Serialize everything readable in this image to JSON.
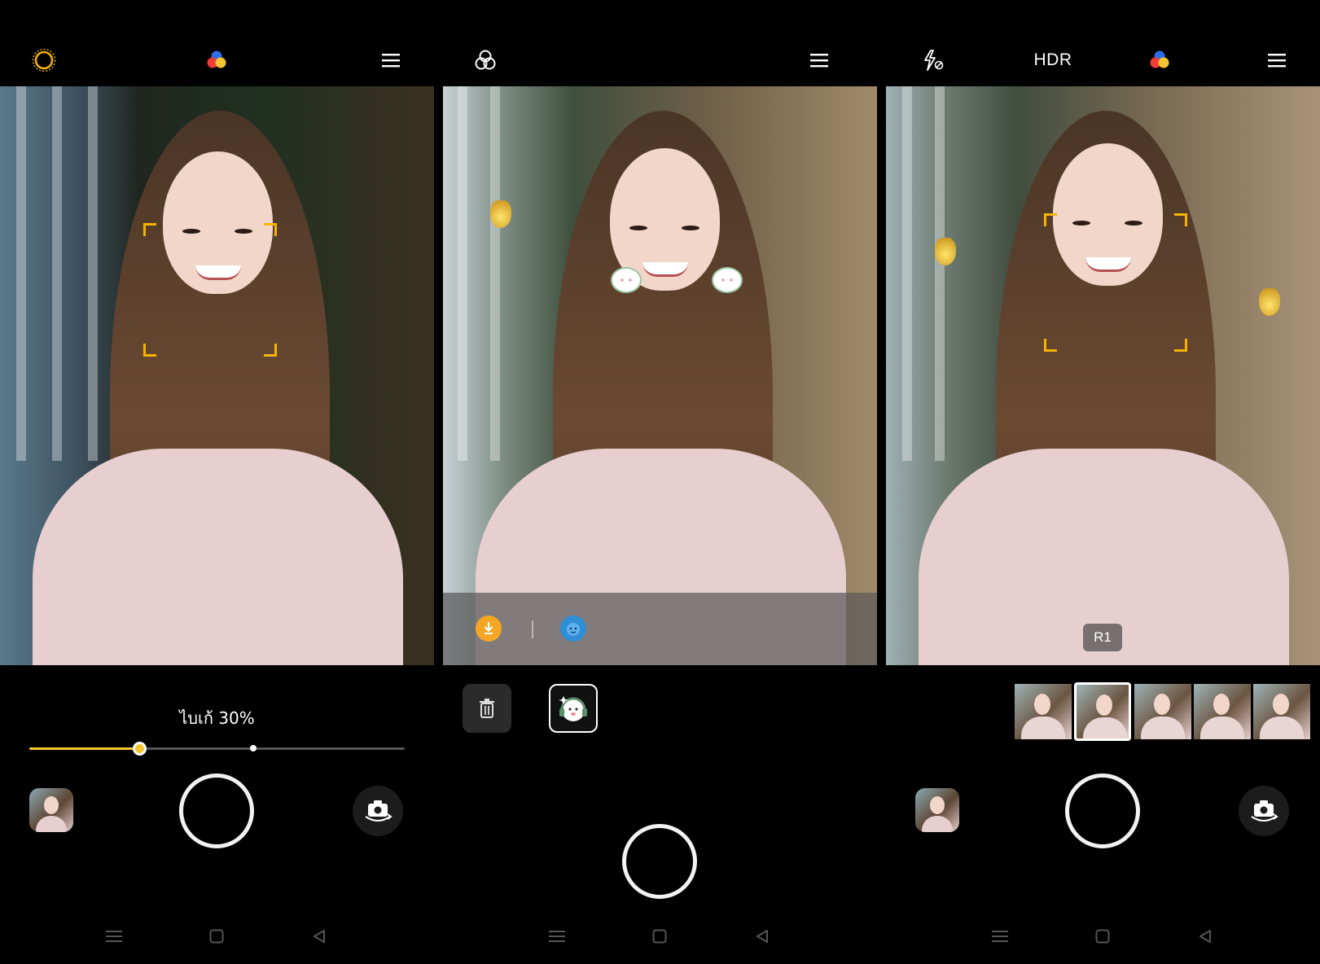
{
  "screens": [
    {
      "name": "beauty-mode",
      "topbar": {
        "left_icon": "sun-icon",
        "center_icon": "color-filter-icon",
        "right_icon": "menu-icon"
      },
      "beauty": {
        "label": "ไบเก้ 30%",
        "level": 0.3
      },
      "controls": {
        "thumbnail": "gallery-thumbnail",
        "shutter": "shutter-button",
        "flip": "camera-flip-icon"
      }
    },
    {
      "name": "sticker-mode",
      "topbar": {
        "left_icon": "filters-icon",
        "right_icon": "menu-icon"
      },
      "sticker_bar": {
        "items": [
          "download-icon",
          "sticker-face-icon"
        ]
      },
      "sticker_actions": {
        "delete": "trash-icon",
        "selected": "headphone-cat-sticker-icon"
      },
      "controls": {
        "shutter": "shutter-button"
      }
    },
    {
      "name": "filter-mode",
      "topbar": {
        "flash": "flash-off-icon",
        "hdr": "HDR",
        "center_icon": "color-filter-icon",
        "right_icon": "menu-icon"
      },
      "filter": {
        "badge": "R1",
        "thumb_count": 5,
        "selected_index": 1
      },
      "controls": {
        "thumbnail": "gallery-thumbnail",
        "shutter": "shutter-button",
        "flip": "camera-flip-icon"
      }
    }
  ],
  "colors": {
    "accent": "#f4b400",
    "slider": "#f4c531",
    "download": "#f5a623",
    "sticker_face": "#2e8ed6"
  },
  "navbar": {
    "icons": [
      "recent-apps-icon",
      "home-icon",
      "back-icon"
    ]
  }
}
